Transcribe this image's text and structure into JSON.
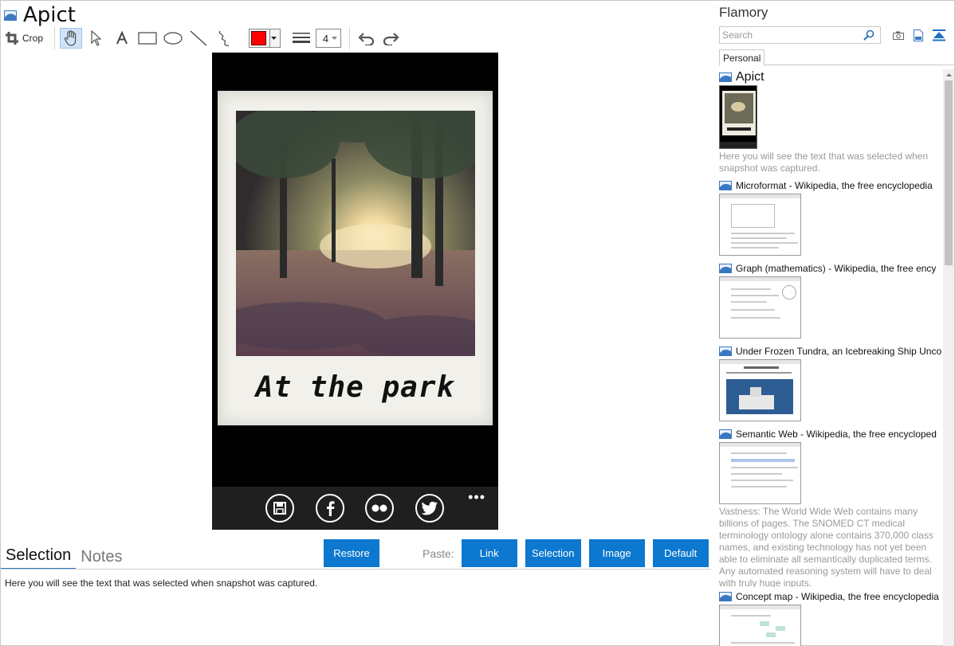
{
  "app": {
    "title": "Apict"
  },
  "toolbar": {
    "crop_label": "Crop",
    "line_width_value": "4",
    "pen_color": "#ff0000"
  },
  "canvas": {
    "caption": "At the park"
  },
  "bottom": {
    "tabs": [
      {
        "label": "Selection",
        "active": true
      },
      {
        "label": "Notes",
        "active": false
      }
    ],
    "restore_label": "Restore",
    "paste_label": "Paste:",
    "paste_buttons": [
      "Link",
      "Selection",
      "Image",
      "Default"
    ],
    "selection_text": "Here you will see the text that was selected when snapshot was captured."
  },
  "flamory": {
    "title": "Flamory",
    "search_placeholder": "Search",
    "tabs": [
      "Personal"
    ],
    "entries": [
      {
        "title": "Apict",
        "desc": "Here you will see the text that was selected when snapshot was captured."
      },
      {
        "title": "Microformat - Wikipedia, the free encyclopedia",
        "desc": ""
      },
      {
        "title": "Graph (mathematics) - Wikipedia, the free ency",
        "desc": ""
      },
      {
        "title": "Under Frozen Tundra, an Icebreaking Ship Unco",
        "desc": ""
      },
      {
        "title": "Semantic Web - Wikipedia, the free encycloped",
        "desc": "Vastness: The World Wide Web contains many billions of pages. The SNOMED CT medical terminology ontology alone contains 370,000 class names, and existing technology has not yet been able to eliminate all semantically duplicated terms. Any automated reasoning system will have to deal with truly huge inputs."
      },
      {
        "title": "Concept map - Wikipedia, the free encyclopedia",
        "desc": ""
      }
    ]
  },
  "colors": {
    "accent": "#0d78cf",
    "selected_tool_bg": "#cfe3f8",
    "pen": "#ff0000"
  }
}
